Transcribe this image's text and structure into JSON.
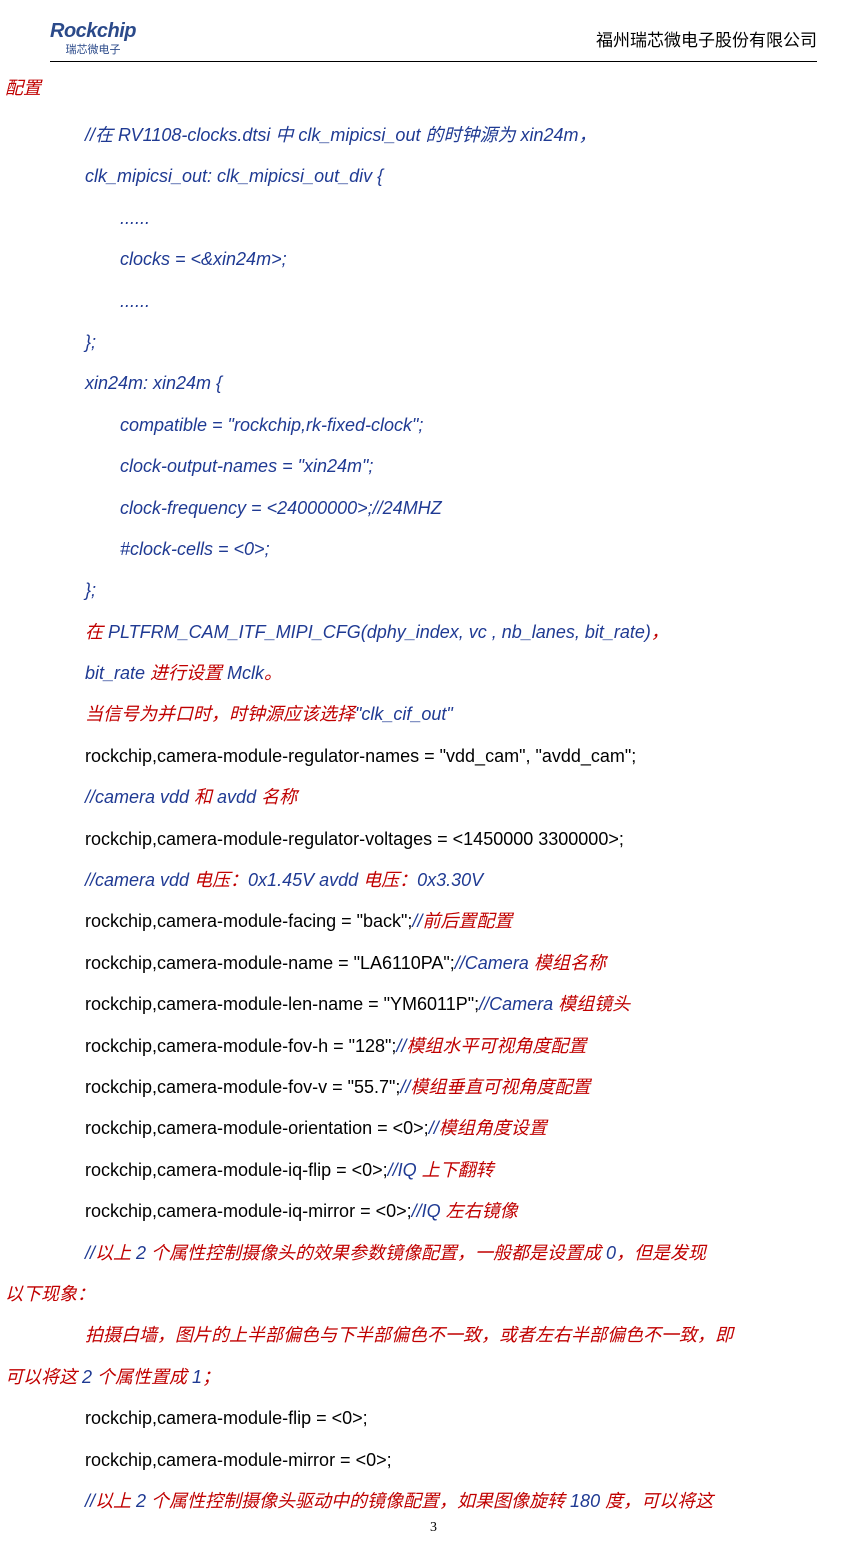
{
  "header": {
    "logo_main": "Rockchip",
    "logo_sub": "瑞芯微电子",
    "company": "福州瑞芯微电子股份有限公司"
  },
  "section_title": "配置",
  "lines": [
    {
      "cls": "line italic-blue",
      "text": "//在 RV1108-clocks.dtsi 中 clk_mipicsi_out 的时钟源为 xin24m，"
    },
    {
      "cls": "line italic-blue",
      "text": "clk_mipicsi_out: clk_mipicsi_out_div {"
    },
    {
      "cls": "line indent2 italic-blue",
      "text": "......"
    },
    {
      "cls": "line indent2 italic-blue",
      "text": "clocks = <&xin24m>;"
    },
    {
      "cls": "line indent2 italic-blue",
      "text": "......"
    },
    {
      "cls": "line italic-blue",
      "text": "};"
    },
    {
      "cls": "line italic-blue",
      "text": "xin24m: xin24m {"
    },
    {
      "cls": "line indent2 italic-blue",
      "text": "compatible = \"rockchip,rk-fixed-clock\";"
    },
    {
      "cls": "line indent2 italic-blue",
      "text": "clock-output-names = \"xin24m\";"
    },
    {
      "cls": "line indent2 italic-blue",
      "text": "clock-frequency = <24000000>;//24MHZ"
    },
    {
      "cls": "line indent2 italic-blue",
      "text": "#clock-cells = <0>;"
    },
    {
      "cls": "line italic-blue",
      "text": "};"
    },
    {
      "cls": "line italic-blue",
      "html": "<span class='italic-red'>在</span> PLTFRM_CAM_ITF_MIPI_CFG(dphy_index, vc , nb_lanes, bit_rate)<span class='italic-red'>，</span>"
    },
    {
      "cls": "line italic-blue",
      "html": "bit_rate <span class='italic-red'>进行设置</span> Mclk<span class='italic-red'>。</span>"
    },
    {
      "cls": "line italic-red",
      "html": "当信号为并口时，时钟源应该选择<span class='italic-blue'>\"clk_cif_out\"</span>"
    },
    {
      "cls": "line black",
      "text": "rockchip,camera-module-regulator-names = \"vdd_cam\", \"avdd_cam\";"
    },
    {
      "cls": "line italic-blue",
      "html": "//camera vdd <span class='italic-red'>和</span> avdd <span class='italic-red'>名称</span>"
    },
    {
      "cls": "line black",
      "text": "rockchip,camera-module-regulator-voltages = <1450000 3300000>;"
    },
    {
      "cls": "line italic-blue",
      "html": "//camera vdd <span class='italic-red'>电压：</span>0x1.45V avdd <span class='italic-red'>电压：</span>0x3.30V"
    },
    {
      "cls": "line black",
      "html": "rockchip,camera-module-facing = \"back\";<span class='italic-blue'>//</span><span class='italic-red'>前后置配置</span>"
    },
    {
      "cls": "line black",
      "html": "rockchip,camera-module-name = \"LA6110PA\";<span class='italic-blue'>//Camera </span><span class='italic-red'>模组名称</span>"
    },
    {
      "cls": "line black",
      "html": "rockchip,camera-module-len-name = \"YM6011P\";<span class='italic-blue'>//Camera </span><span class='italic-red'>模组镜头</span>"
    },
    {
      "cls": "line black",
      "html": "rockchip,camera-module-fov-h = \"128\";<span class='italic-blue'>//</span><span class='italic-red'>模组水平可视角度配置</span>"
    },
    {
      "cls": "line black",
      "html": "rockchip,camera-module-fov-v = \"55.7\";<span class='italic-blue'>//</span><span class='italic-red'>模组垂直可视角度配置</span>"
    },
    {
      "cls": "line black",
      "html": "rockchip,camera-module-orientation = <0>;<span class='italic-blue'>//</span><span class='italic-red'>模组角度设置</span>"
    },
    {
      "cls": "line black",
      "html": "rockchip,camera-module-iq-flip = <0>;<span class='italic-blue'>//IQ </span><span class='italic-red'>上下翻转</span>"
    },
    {
      "cls": "line black",
      "html": "rockchip,camera-module-iq-mirror = <0>;<span class='italic-blue'>//IQ </span><span class='italic-red'>左右镜像</span>"
    },
    {
      "cls": "line italic-red",
      "html": "<span class='italic-blue'>//</span>以上 <span class='italic-blue'>2</span> 个属性控制摄像头的效果参数镜像配置，一般都是设置成 <span class='italic-blue'>0</span>，但是发现"
    },
    {
      "cls": "line line-outdent italic-red",
      "text": "以下现象："
    },
    {
      "cls": "line italic-red",
      "text": "拍摄白墙，图片的上半部偏色与下半部偏色不一致，或者左右半部偏色不一致，即"
    },
    {
      "cls": "line line-outdent italic-red",
      "html": "可以将这 <span class='italic-blue'>2</span> 个属性置成 <span class='italic-blue'>1</span>；"
    },
    {
      "cls": "line black",
      "text": "rockchip,camera-module-flip = <0>;"
    },
    {
      "cls": "line black",
      "text": "rockchip,camera-module-mirror = <0>;"
    },
    {
      "cls": "line italic-red",
      "html": "<span class='italic-blue'>//</span>以上 <span class='italic-blue'>2</span> 个属性控制摄像头驱动中的镜像配置，如果图像旋转 <span class='italic-blue'>180</span> 度，可以将这"
    }
  ],
  "page_number": "3"
}
